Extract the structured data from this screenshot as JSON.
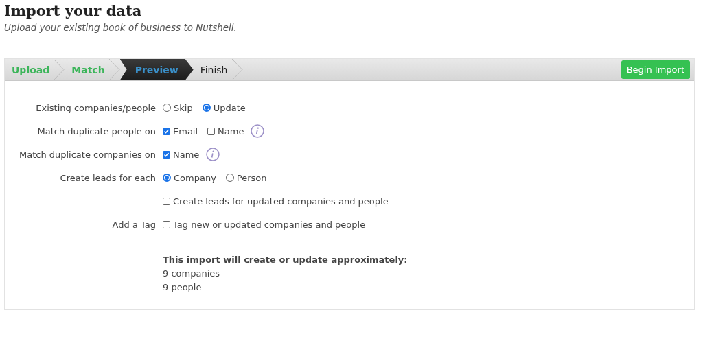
{
  "header": {
    "title": "Import your data",
    "subtitle": "Upload your existing book of business to Nutshell."
  },
  "steps": [
    {
      "label": "Upload",
      "done": true,
      "selected": false
    },
    {
      "label": "Match",
      "done": true,
      "selected": false
    },
    {
      "label": "Preview",
      "done": false,
      "selected": true
    },
    {
      "label": "Finish",
      "done": false,
      "selected": false
    }
  ],
  "begin_button": "Begin Import",
  "settings": [
    {
      "label": "Existing companies/people",
      "info": false,
      "options": [
        {
          "kind": "radio",
          "label": "Skip",
          "checked": false
        },
        {
          "kind": "radio",
          "label": "Update",
          "checked": true
        }
      ]
    },
    {
      "label": "Match duplicate people on",
      "info": true,
      "options": [
        {
          "kind": "checkbox",
          "label": "Email",
          "checked": true
        },
        {
          "kind": "checkbox",
          "label": "Name",
          "checked": false
        }
      ]
    },
    {
      "label": "Match duplicate companies on",
      "info": true,
      "options": [
        {
          "kind": "checkbox",
          "label": "Name",
          "checked": true
        }
      ]
    },
    {
      "label": "Create leads for each",
      "info": false,
      "options": [
        {
          "kind": "radio",
          "label": "Company",
          "checked": true
        },
        {
          "kind": "radio",
          "label": "Person",
          "checked": false
        }
      ]
    },
    {
      "info": false,
      "options": [
        {
          "kind": "checkbox",
          "label": "Create leads for updated companies and people",
          "checked": false
        }
      ]
    },
    {
      "label": "Add a Tag",
      "info": false,
      "options": [
        {
          "kind": "checkbox",
          "label": "Tag new or updated companies and people",
          "checked": false
        }
      ]
    }
  ],
  "summary": {
    "heading": "This import will create or update approximately:",
    "lines": [
      "9 companies",
      "9 people"
    ]
  }
}
